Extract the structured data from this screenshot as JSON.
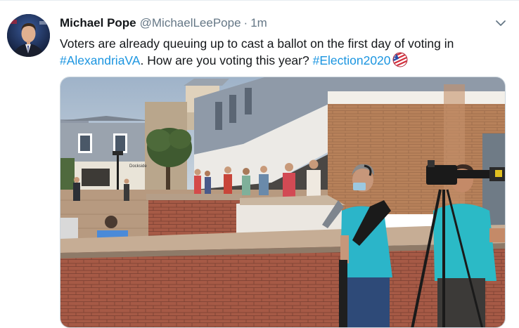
{
  "tweet": {
    "display_name": "Michael Pope",
    "handle": "@MichaelLeePope",
    "separator": "·",
    "timestamp": "1m",
    "text_line1": "Voters are already queuing up to cast a ballot on the first day of voting in",
    "hashtag_1": "#AlexandriaVA",
    "text_middle": ". How are you voting this year? ",
    "hashtag_2": "#Election2020",
    "photo_sign": "Dockside"
  },
  "icons": {
    "caret": "chevron-down-icon",
    "emoji": "us-flag-ballot-emoji"
  },
  "colors": {
    "link": "#1b95e0",
    "secondary_text": "#657786",
    "primary_text": "#14171a"
  }
}
